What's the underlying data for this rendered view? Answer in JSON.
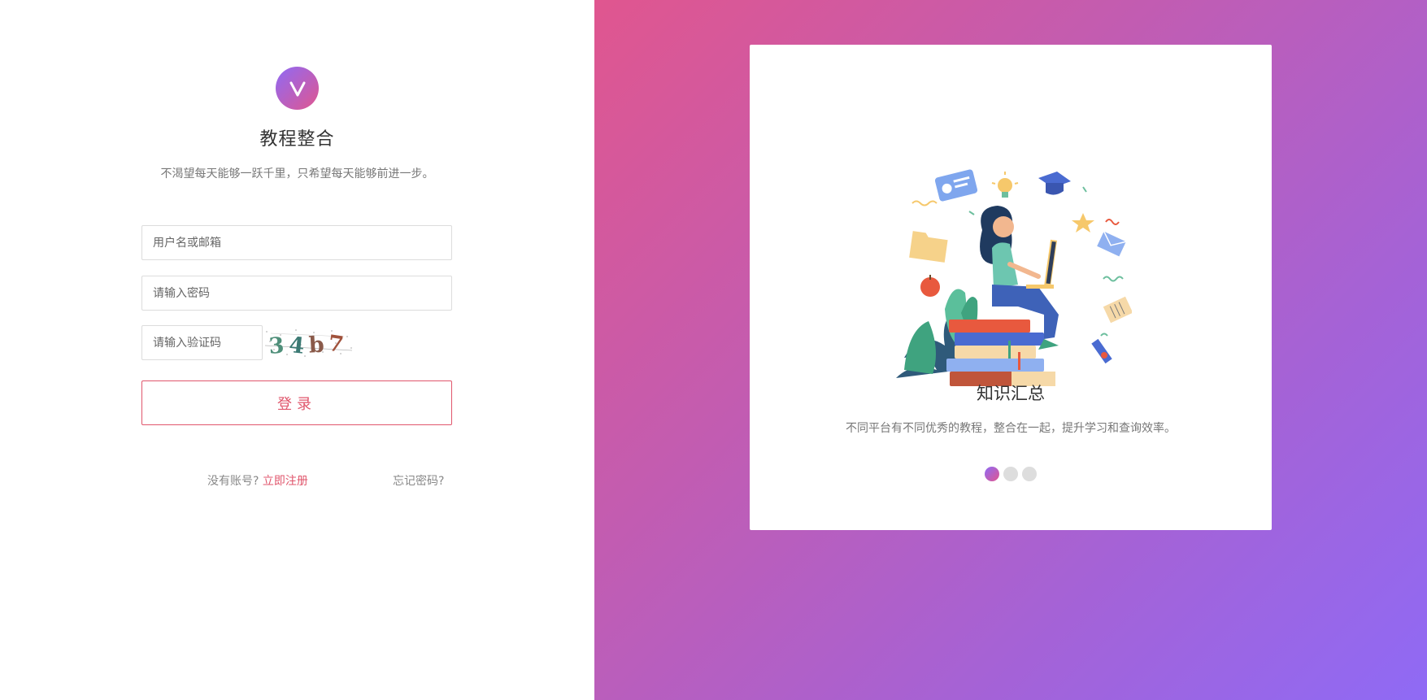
{
  "app": {
    "title": "教程整合",
    "slogan": "不渴望每天能够一跃千里，只希望每天能够前进一步。",
    "logo_letter": "V"
  },
  "form": {
    "username_placeholder": "用户名或邮箱",
    "password_placeholder": "请输入密码",
    "captcha_placeholder": "请输入验证码",
    "captcha_image_text": "34b7",
    "login_label": "登录"
  },
  "links": {
    "no_account_text": "没有账号?",
    "register_label": "立即注册",
    "forgot_label": "忘记密码?"
  },
  "carousel": {
    "title": "知识汇总",
    "description": "不同平台有不同优秀的教程，整合在一起，提升学习和查询效率。",
    "slide_count": 3,
    "active_index": 0
  },
  "colors": {
    "accent": "#e0566c",
    "gradient_start": "#e0568f",
    "gradient_end": "#8f6af5"
  }
}
